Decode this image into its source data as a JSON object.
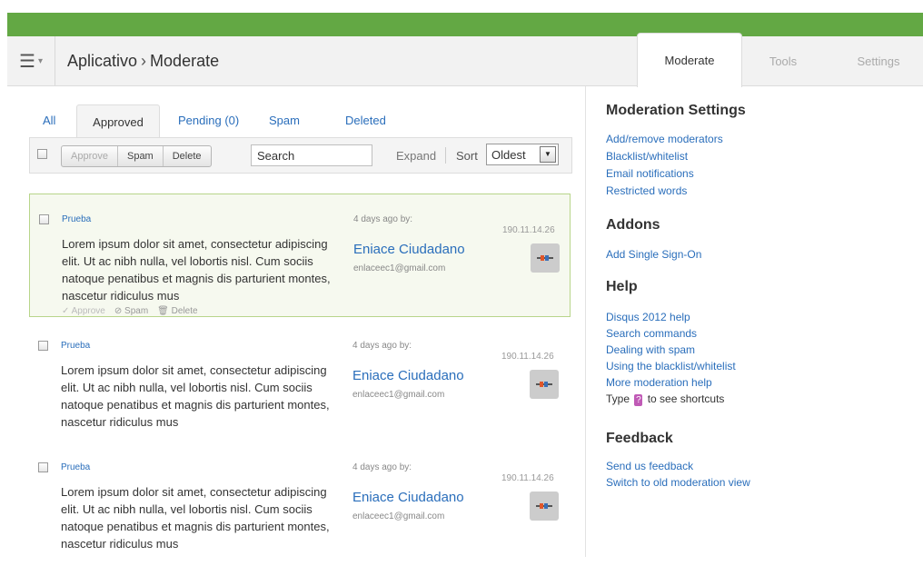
{
  "header": {
    "menu_icon": "hamburger-menu-icon",
    "breadcrumb": [
      "Aplicativo",
      "Moderate"
    ],
    "breadcrumb_sep": "›",
    "tabs": [
      {
        "label": "Moderate",
        "active": true
      },
      {
        "label": "Tools",
        "active": false
      },
      {
        "label": "Settings",
        "active": false
      }
    ]
  },
  "filter_tabs": [
    {
      "label": "All"
    },
    {
      "label": "Approved",
      "active": true
    },
    {
      "label": "Pending (0)"
    },
    {
      "label": "Spam"
    },
    {
      "label": "Deleted"
    }
  ],
  "toolbar": {
    "approve_label": "Approve",
    "spam_label": "Spam",
    "delete_label": "Delete",
    "search_placeholder": "Search",
    "expand_label": "Expand",
    "sort_label": "Sort",
    "sort_value": "Oldest"
  },
  "comments": [
    {
      "link": "Prueba",
      "body": "Lorem ipsum dolor sit amet, consectetur adipiscing elit. Ut ac nibh nulla, vel lobortis nisl. Cum sociis natoque penatibus et magnis dis parturient montes, nascetur ridiculus mus",
      "time": "4 days ago by:",
      "author": "Eniace Ciudadano",
      "email": "enlaceec1@gmail.com",
      "ip": "190.11.14.26",
      "selected": true,
      "actions": {
        "approve": "Approve",
        "spam": "Spam",
        "delete": "Delete"
      }
    },
    {
      "link": "Prueba",
      "body": "Lorem ipsum dolor sit amet, consectetur adipiscing elit. Ut ac nibh nulla, vel lobortis nisl. Cum sociis natoque penatibus et magnis dis parturient montes, nascetur ridiculus mus",
      "time": "4 days ago by:",
      "author": "Eniace Ciudadano",
      "email": "enlaceec1@gmail.com",
      "ip": "190.11.14.26"
    },
    {
      "link": "Prueba",
      "body": "Lorem ipsum dolor sit amet, consectetur adipiscing elit. Ut ac nibh nulla, vel lobortis nisl. Cum sociis natoque penatibus et magnis dis parturient montes, nascetur ridiculus mus",
      "time": "4 days ago by:",
      "author": "Eniace Ciudadano",
      "email": "enlaceec1@gmail.com",
      "ip": "190.11.14.26"
    }
  ],
  "sidebar": {
    "moderation_settings": {
      "title": "Moderation Settings",
      "links": [
        "Add/remove moderators",
        "Blacklist/whitelist",
        "Email notifications",
        "Restricted words"
      ]
    },
    "addons": {
      "title": "Addons",
      "links": [
        "Add Single Sign-On"
      ]
    },
    "help": {
      "title": "Help",
      "links": [
        "Disqus 2012 help",
        "Search commands",
        "Dealing with spam",
        "Using the blacklist/whitelist",
        "More moderation help"
      ],
      "shortcut_prefix": "Type",
      "shortcut_key": "?",
      "shortcut_suffix": "to see shortcuts"
    },
    "feedback": {
      "title": "Feedback",
      "links": [
        "Send us feedback",
        "Switch to old moderation view"
      ]
    }
  },
  "colors": {
    "brand_green": "#63a844",
    "link_blue": "#2a6ebb",
    "selected_border": "#b8d58a",
    "shortcut_key": "#c05ab6"
  }
}
